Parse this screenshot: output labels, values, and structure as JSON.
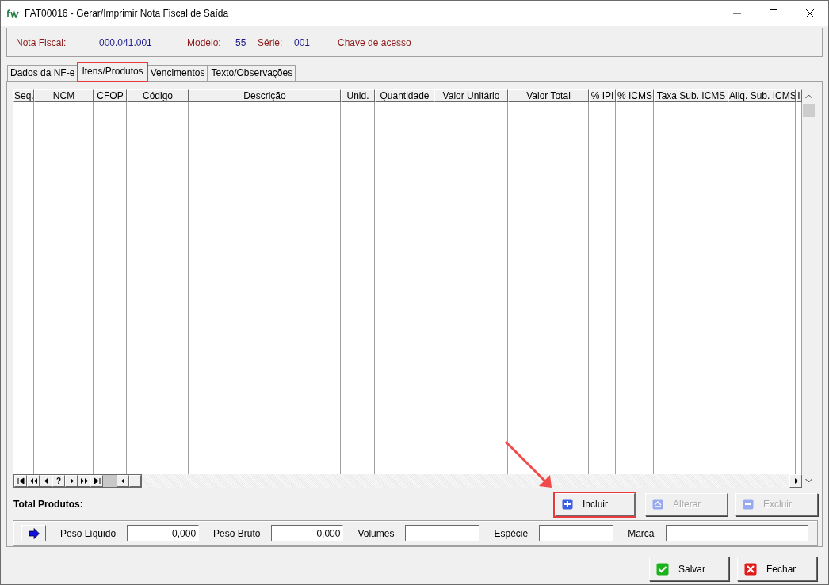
{
  "window": {
    "title": "FAT00016 - Gerar/Imprimir Nota Fiscal de Saída"
  },
  "header": {
    "fields": [
      {
        "label": "Nota Fiscal:",
        "value": "000.041.001"
      },
      {
        "label": "Modelo:",
        "value": "55"
      },
      {
        "label": "Série:",
        "value": "001"
      }
    ],
    "link": "Chave de acesso"
  },
  "tabs": [
    {
      "label": "Dados da NF-e",
      "selected": false,
      "highlighted": false
    },
    {
      "label": "Itens/Produtos",
      "selected": true,
      "highlighted": true
    },
    {
      "label": "Vencimentos",
      "selected": false,
      "highlighted": false
    },
    {
      "label": "Texto/Observações",
      "selected": false,
      "highlighted": false
    }
  ],
  "table": {
    "columns": [
      "Seq.",
      "NCM",
      "CFOP",
      "Código",
      "Descrição",
      "Unid.",
      "Quantidade",
      "Valor Unitário",
      "Valor Total",
      "% IPI",
      "% ICMS",
      "Taxa Sub. ICMS",
      "Aliq. Sub. ICMS",
      "I"
    ]
  },
  "navigator": {
    "help_label": "?"
  },
  "total_label": "Total Produtos:",
  "item_buttons": [
    {
      "label": "Incluir",
      "kind": "add",
      "disabled": false,
      "highlighted": true
    },
    {
      "label": "Alterar",
      "kind": "edit",
      "disabled": true,
      "highlighted": false
    },
    {
      "label": "Excluir",
      "kind": "delete",
      "disabled": true,
      "highlighted": false
    }
  ],
  "weights": {
    "fields": [
      {
        "label": "Peso Líquido",
        "value": "0,000"
      },
      {
        "label": "Peso Bruto",
        "value": "0,000"
      },
      {
        "label": "Volumes"
      },
      {
        "label": "Espécie"
      },
      {
        "label": "Marca"
      }
    ]
  },
  "footer_buttons": [
    {
      "label": "Salvar",
      "kind": "save"
    },
    {
      "label": "Fechar",
      "kind": "close"
    }
  ],
  "annotation": {
    "arrow": true
  }
}
